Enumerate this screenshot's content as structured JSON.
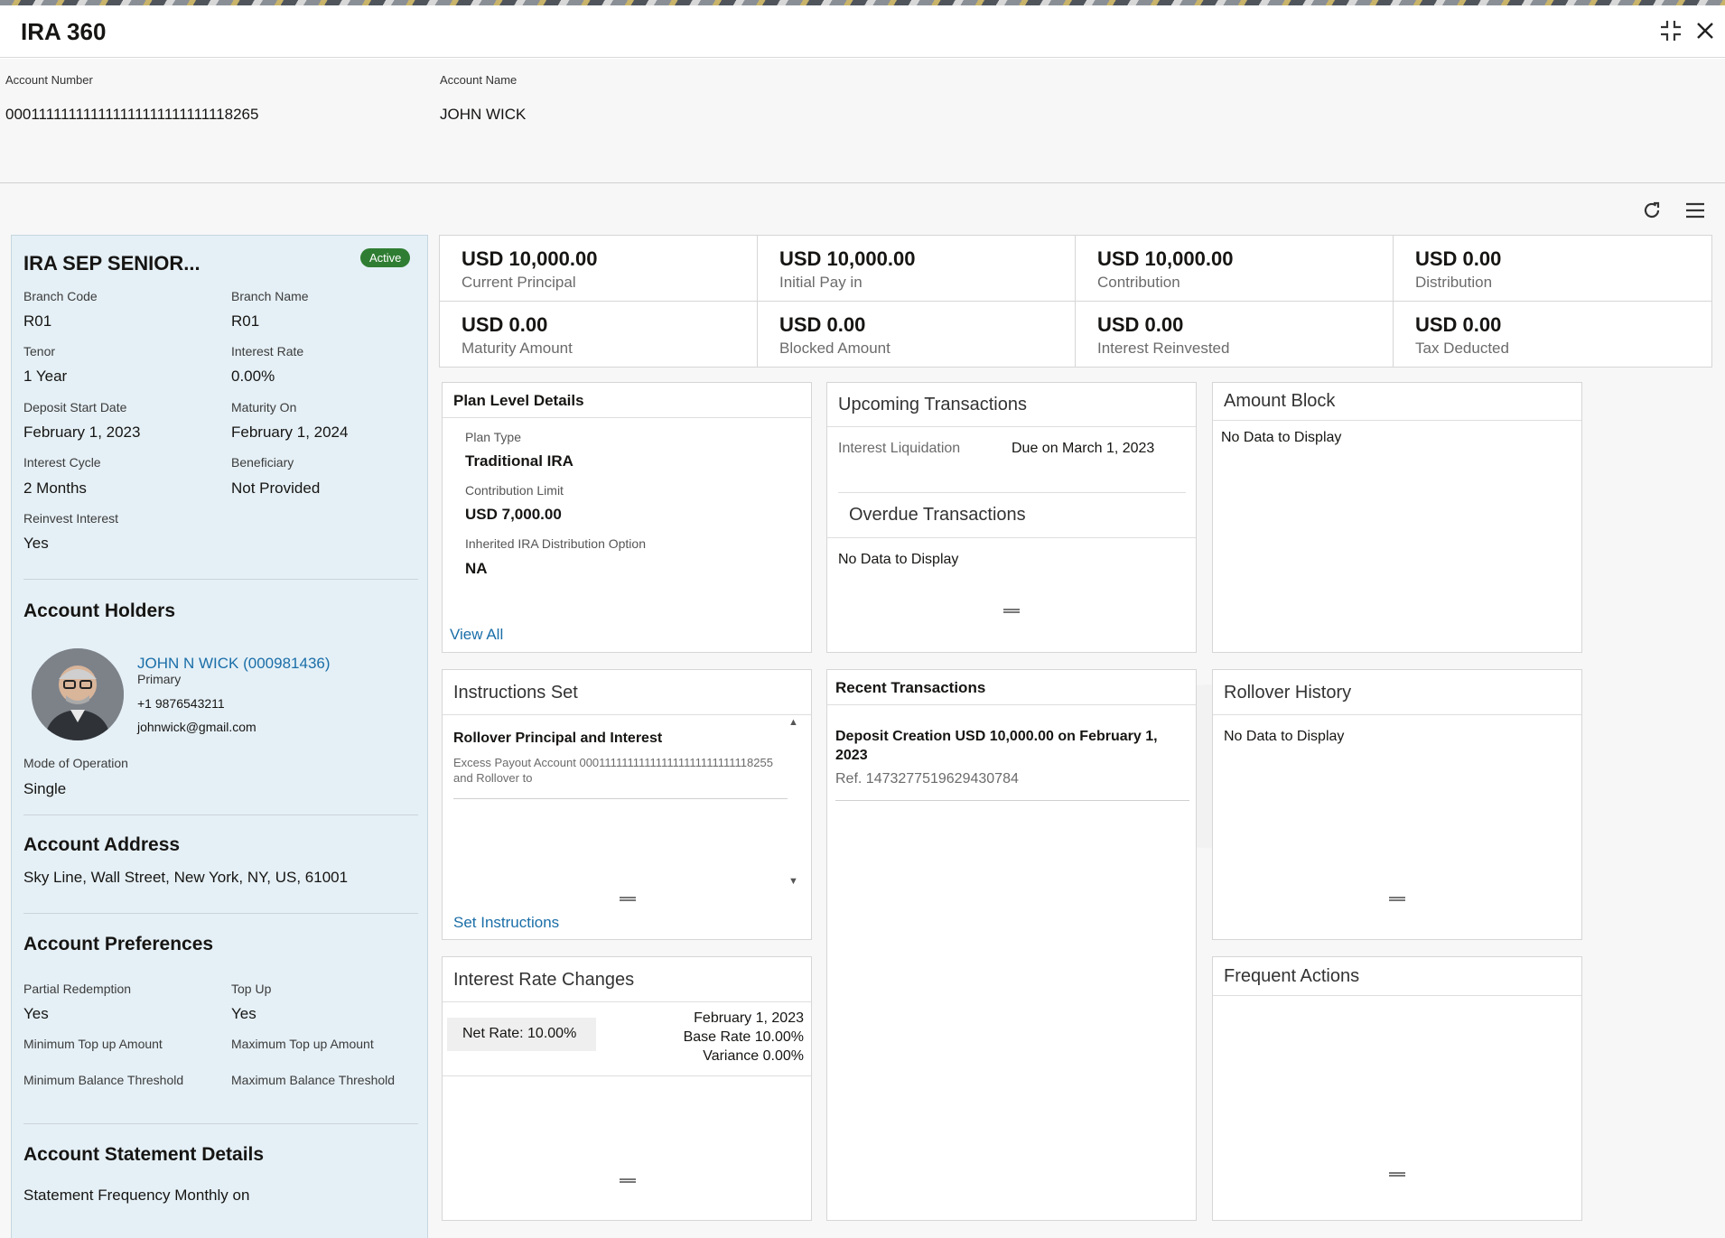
{
  "window": {
    "title": "IRA 360"
  },
  "account": {
    "number_label": "Account Number",
    "number": "000111111111111111111111111118265",
    "name_label": "Account Name",
    "name": "JOHN WICK"
  },
  "summary": {
    "product": "IRA SEP SENIOR...",
    "status": "Active",
    "fields": [
      {
        "label": "Branch Code",
        "value": "R01"
      },
      {
        "label": "Branch Name",
        "value": "R01"
      },
      {
        "label": "Tenor",
        "value": "1 Year"
      },
      {
        "label": "Interest Rate",
        "value": "0.00%"
      },
      {
        "label": "Deposit Start Date",
        "value": "February 1, 2023"
      },
      {
        "label": "Maturity On",
        "value": "February 1, 2024"
      },
      {
        "label": "Interest Cycle",
        "value": "2 Months"
      },
      {
        "label": "Beneficiary",
        "value": "Not Provided"
      },
      {
        "label": "Reinvest Interest",
        "value": "Yes"
      }
    ]
  },
  "holders": {
    "heading": "Account Holders",
    "name": "JOHN N WICK (000981436)",
    "role": "Primary",
    "phone": "+1 9876543211",
    "email": "johnwick@gmail.com",
    "mode_label": "Mode of Operation",
    "mode_value": "Single"
  },
  "address": {
    "heading": "Account Address",
    "value": "Sky Line, Wall Street, New York, NY, US, 61001"
  },
  "preferences": {
    "heading": "Account Preferences",
    "partial_label": "Partial Redemption",
    "partial_value": "Yes",
    "topup_label": "Top Up",
    "topup_value": "Yes",
    "min_topup_label": "Minimum Top up Amount",
    "max_topup_label": "Maximum Top up Amount",
    "min_bal_label": "Minimum Balance Threshold",
    "max_bal_label": "Maximum Balance Threshold"
  },
  "statement": {
    "heading": "Account Statement Details",
    "value": "Statement Frequency Monthly on"
  },
  "metrics": [
    {
      "value": "USD 10,000.00",
      "label": "Current Principal"
    },
    {
      "value": "USD 10,000.00",
      "label": "Initial Pay in"
    },
    {
      "value": "USD 10,000.00",
      "label": "Contribution"
    },
    {
      "value": "USD 0.00",
      "label": "Distribution"
    },
    {
      "value": "USD 0.00",
      "label": "Maturity Amount"
    },
    {
      "value": "USD 0.00",
      "label": "Blocked Amount"
    },
    {
      "value": "USD 0.00",
      "label": "Interest Reinvested"
    },
    {
      "value": "USD 0.00",
      "label": "Tax Deducted"
    }
  ],
  "plan": {
    "title": "Plan Level Details",
    "type_label": "Plan Type",
    "type_value": "Traditional IRA",
    "limit_label": "Contribution Limit",
    "limit_value": "USD 7,000.00",
    "inherit_label": "Inherited IRA Distribution Option",
    "inherit_value": "NA",
    "view_all": "View All"
  },
  "upcoming": {
    "title": "Upcoming Transactions",
    "item_label": "Interest Liquidation",
    "item_value": "Due on March 1, 2023",
    "overdue_title": "Overdue Transactions",
    "overdue_empty": "No Data to Display"
  },
  "amount_block": {
    "title": "Amount Block",
    "empty": "No Data to Display"
  },
  "instructions": {
    "title": "Instructions Set",
    "item_title": "Rollover Principal and Interest",
    "item_desc": "Excess Payout Account 000111111111111111111111111118255 and Rollover to",
    "link": "Set Instructions"
  },
  "recent": {
    "title": "Recent Transactions",
    "item_title": "Deposit Creation USD 10,000.00 on February 1, 2023",
    "item_ref": "Ref. 1473277519629430784"
  },
  "rollover": {
    "title": "Rollover History",
    "empty": "No Data to Display"
  },
  "rates": {
    "title": "Interest Rate Changes",
    "net": "Net Rate: 10.00%",
    "date": "February 1, 2023",
    "base": "Base Rate 10.00%",
    "variance": "Variance 0.00%"
  },
  "frequent": {
    "title": "Frequent Actions"
  }
}
